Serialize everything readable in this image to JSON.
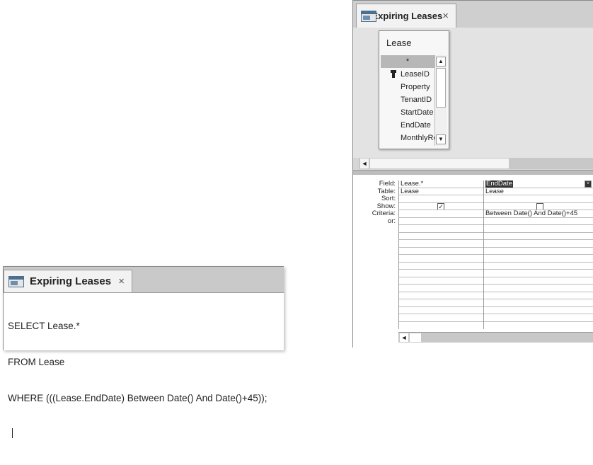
{
  "sql_window": {
    "tab_title": "Expiring Leases",
    "close_glyph": "×",
    "sql_lines": [
      "SELECT Lease.*",
      "FROM Lease",
      "WHERE (((Lease.EndDate) Between Date() And Date()+45));"
    ]
  },
  "design_window": {
    "tab_title": "Expiring Leases",
    "close_glyph": "×",
    "table_box": {
      "title": "Lease",
      "fields": [
        "*",
        "LeaseID",
        "Property",
        "TenantID",
        "StartDate",
        "EndDate",
        "MonthlyRent"
      ],
      "key_field": "LeaseID"
    },
    "scroll_glyphs": {
      "up": "▲",
      "down": "▼",
      "left": "◄",
      "dropdown": "˅"
    },
    "grid": {
      "row_labels": [
        "Field:",
        "Table:",
        "Sort:",
        "Show:",
        "Criteria:",
        "or:"
      ],
      "columns": [
        {
          "field": "Lease.*",
          "table": "Lease",
          "sort": "",
          "show": true,
          "show_glyph": "✓",
          "criteria": "",
          "or": ""
        },
        {
          "field": "EndDate",
          "table": "Lease",
          "sort": "",
          "show": false,
          "show_glyph": "",
          "criteria": "Between Date() And Date()+45",
          "or": ""
        }
      ]
    }
  }
}
